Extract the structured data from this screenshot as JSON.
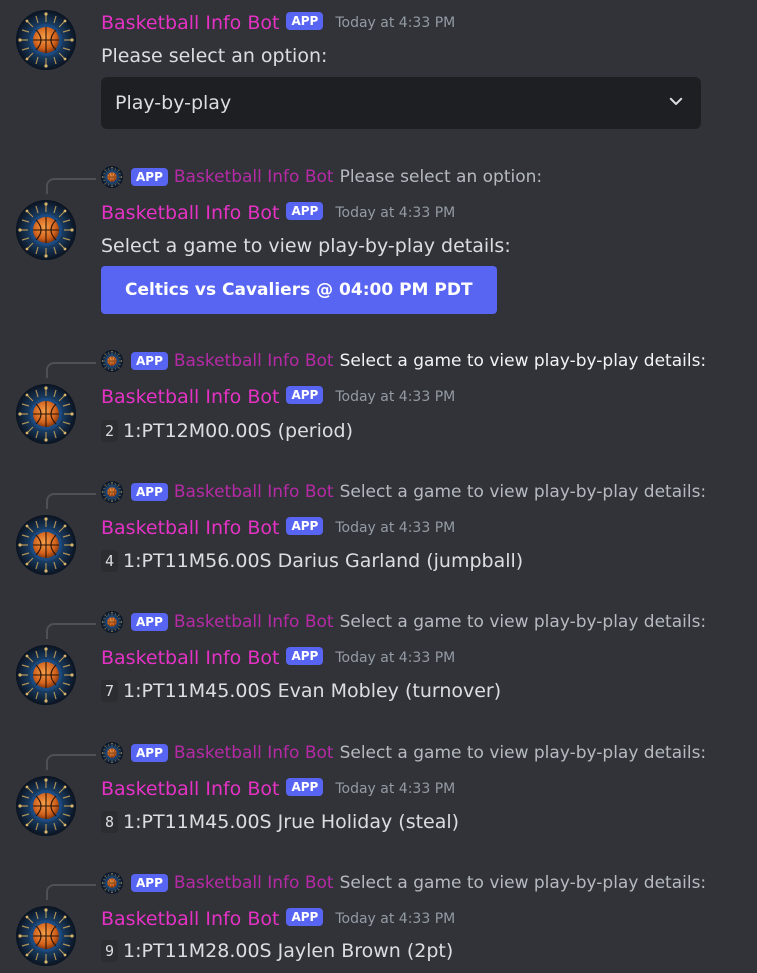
{
  "bot": {
    "name": "Basketball Info Bot",
    "badge": "APP",
    "timestamp": "Today at 4:33 PM"
  },
  "first": {
    "text": "Please select an option:",
    "select_value": "Play-by-play"
  },
  "second": {
    "reply_text": "Please select an option:",
    "text": "Select a game to view play-by-play details:",
    "button": "Celtics vs Cavaliers @ 04:00 PM PDT"
  },
  "events": [
    {
      "reply_text": "Select a game to view play-by-play details:",
      "num": "2",
      "text": "1:PT12M00.00S  (period)"
    },
    {
      "reply_text": "Select a game to view play-by-play details:",
      "num": "4",
      "text": "1:PT11M56.00S Darius Garland (jumpball)"
    },
    {
      "reply_text": "Select a game to view play-by-play details:",
      "num": "7",
      "text": "1:PT11M45.00S Evan Mobley (turnover)"
    },
    {
      "reply_text": "Select a game to view play-by-play details:",
      "num": "8",
      "text": "1:PT11M45.00S Jrue Holiday (steal)"
    },
    {
      "reply_text": "Select a game to view play-by-play details:",
      "num": "9",
      "text": "1:PT11M28.00S Jaylen Brown (2pt)"
    }
  ],
  "colors": {
    "background": "#313338",
    "username": "#e532c5",
    "badge": "#5865f2",
    "button": "#5865f2",
    "select_bg": "#1e1f22"
  },
  "icons": {
    "avatar": "basketball-avatar-icon",
    "dropdown": "chevron-down-icon"
  }
}
